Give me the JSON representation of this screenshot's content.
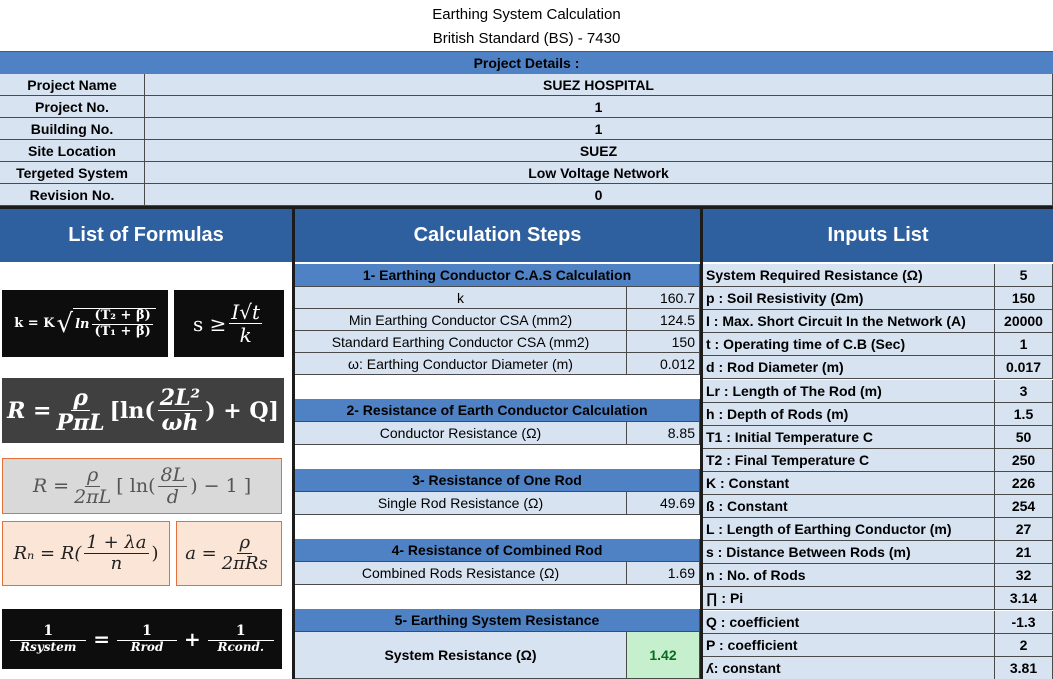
{
  "title": {
    "line1": "Earthing System Calculation",
    "line2": "British Standard (BS) - 7430"
  },
  "project": {
    "header": "Project Details :",
    "rows": [
      {
        "label": "Project Name",
        "value": "SUEZ HOSPITAL"
      },
      {
        "label": "Project No.",
        "value": "1"
      },
      {
        "label": "Building No.",
        "value": "1"
      },
      {
        "label": "Site Location",
        "value": "SUEZ"
      },
      {
        "label": "Tergeted System",
        "value": "Low Voltage Network"
      },
      {
        "label": "Revision No.",
        "value": "0"
      }
    ]
  },
  "headers": {
    "formulas": "List of Formulas",
    "steps": "Calculation Steps",
    "inputs": "Inputs List"
  },
  "formulas": {
    "f1_lhs": "k = K",
    "f1_ln": "ln",
    "f1_num": "(T₂ + β)",
    "f1_den": "(T₁ + β)",
    "f2_lhs": "s ≥",
    "f2_num": "I√t",
    "f2_den": "k",
    "f3_lhs": "R =",
    "f3_num": "ρ",
    "f3_den": "PπL",
    "f3_mid": "[ln(",
    "f3_num2": "2L²",
    "f3_den2": "ωh",
    "f3_tail": ") + Q]",
    "f4_lhs": "R =",
    "f4_num": "ρ",
    "f4_den": "2πL",
    "f4_mid": "[ ln(",
    "f4_num2": "8L",
    "f4_den2": "d",
    "f4_tail": ") − 1 ]",
    "f5_lhs": "Rₙ = R(",
    "f5_num": "1 + λa",
    "f5_den": "n",
    "f5_tail": ")",
    "f6_lhs": "a =",
    "f6_num": "ρ",
    "f6_den": "2πRs",
    "f7_num1": "1",
    "f7_den1": "Rsystem",
    "f7_eq": "=",
    "f7_num2": "1",
    "f7_den2": "Rrod",
    "f7_plus": "+",
    "f7_num3": "1",
    "f7_den3": "Rcond."
  },
  "steps": {
    "s1_title": "1- Earthing Conductor C.A.S Calculation",
    "s1_rows": [
      {
        "label": "k",
        "value": "160.7"
      },
      {
        "label": "Min Earthing Conductor CSA (mm2)",
        "value": "124.5"
      },
      {
        "label": "Standard Earthing Conductor CSA (mm2)",
        "value": "150"
      },
      {
        "label": "ω: Earthing Conductor Diameter (m)",
        "value": "0.012"
      }
    ],
    "s2_title": "2- Resistance of Earth Conductor Calculation",
    "s2_label": "Conductor Resistance (Ω)",
    "s2_value": "8.85",
    "s3_title": "3- Resistance of One Rod",
    "s3_label": "Single Rod Resistance (Ω)",
    "s3_value": "49.69",
    "s4_title": "4- Resistance of Combined Rod",
    "s4_label": "Combined Rods Resistance (Ω)",
    "s4_value": "1.69",
    "s5_title": "5- Earthing System Resistance",
    "s5_label": "System Resistance (Ω)",
    "s5_value": "1.42"
  },
  "inputs": [
    {
      "label": "System Required Resistance (Ω)",
      "value": "5"
    },
    {
      "label": "p : Soil Resistivity (Ωm)",
      "value": "150"
    },
    {
      "label": "I : Max. Short Circuit In the Network (A)",
      "value": "20000"
    },
    {
      "label": "t : Operating time of C.B (Sec)",
      "value": "1"
    },
    {
      "label": "d : Rod Diameter (m)",
      "value": "0.017"
    },
    {
      "label": "Lr : Length of The Rod (m)",
      "value": "3"
    },
    {
      "label": "h : Depth of Rods (m)",
      "value": "1.5"
    },
    {
      "label": "T1 : Initial Temperature C",
      "value": "50"
    },
    {
      "label": "T2 : Final Temperature C",
      "value": "250"
    },
    {
      "label": "K : Constant",
      "value": "226"
    },
    {
      "label": "ß : Constant",
      "value": "254"
    },
    {
      "label": "L : Length of Earthing Conductor (m)",
      "value": "27"
    },
    {
      "label": "s : Distance Between Rods (m)",
      "value": "21"
    },
    {
      "label": "n : No. of Rods",
      "value": "32"
    },
    {
      "label": "∏ : Pi",
      "value": "3.14"
    },
    {
      "label": "Q : coefficient",
      "value": "-1.3"
    },
    {
      "label": "P : coefficient",
      "value": "2"
    },
    {
      "label": "ʎ: constant",
      "value": "3.81"
    }
  ],
  "colors": {
    "light_blue": "#d8e3f1",
    "mid_blue": "#4f82c4",
    "dark_blue": "#2e5f9e",
    "result_green": "#c6efce",
    "result_text": "#0a6a1e"
  }
}
